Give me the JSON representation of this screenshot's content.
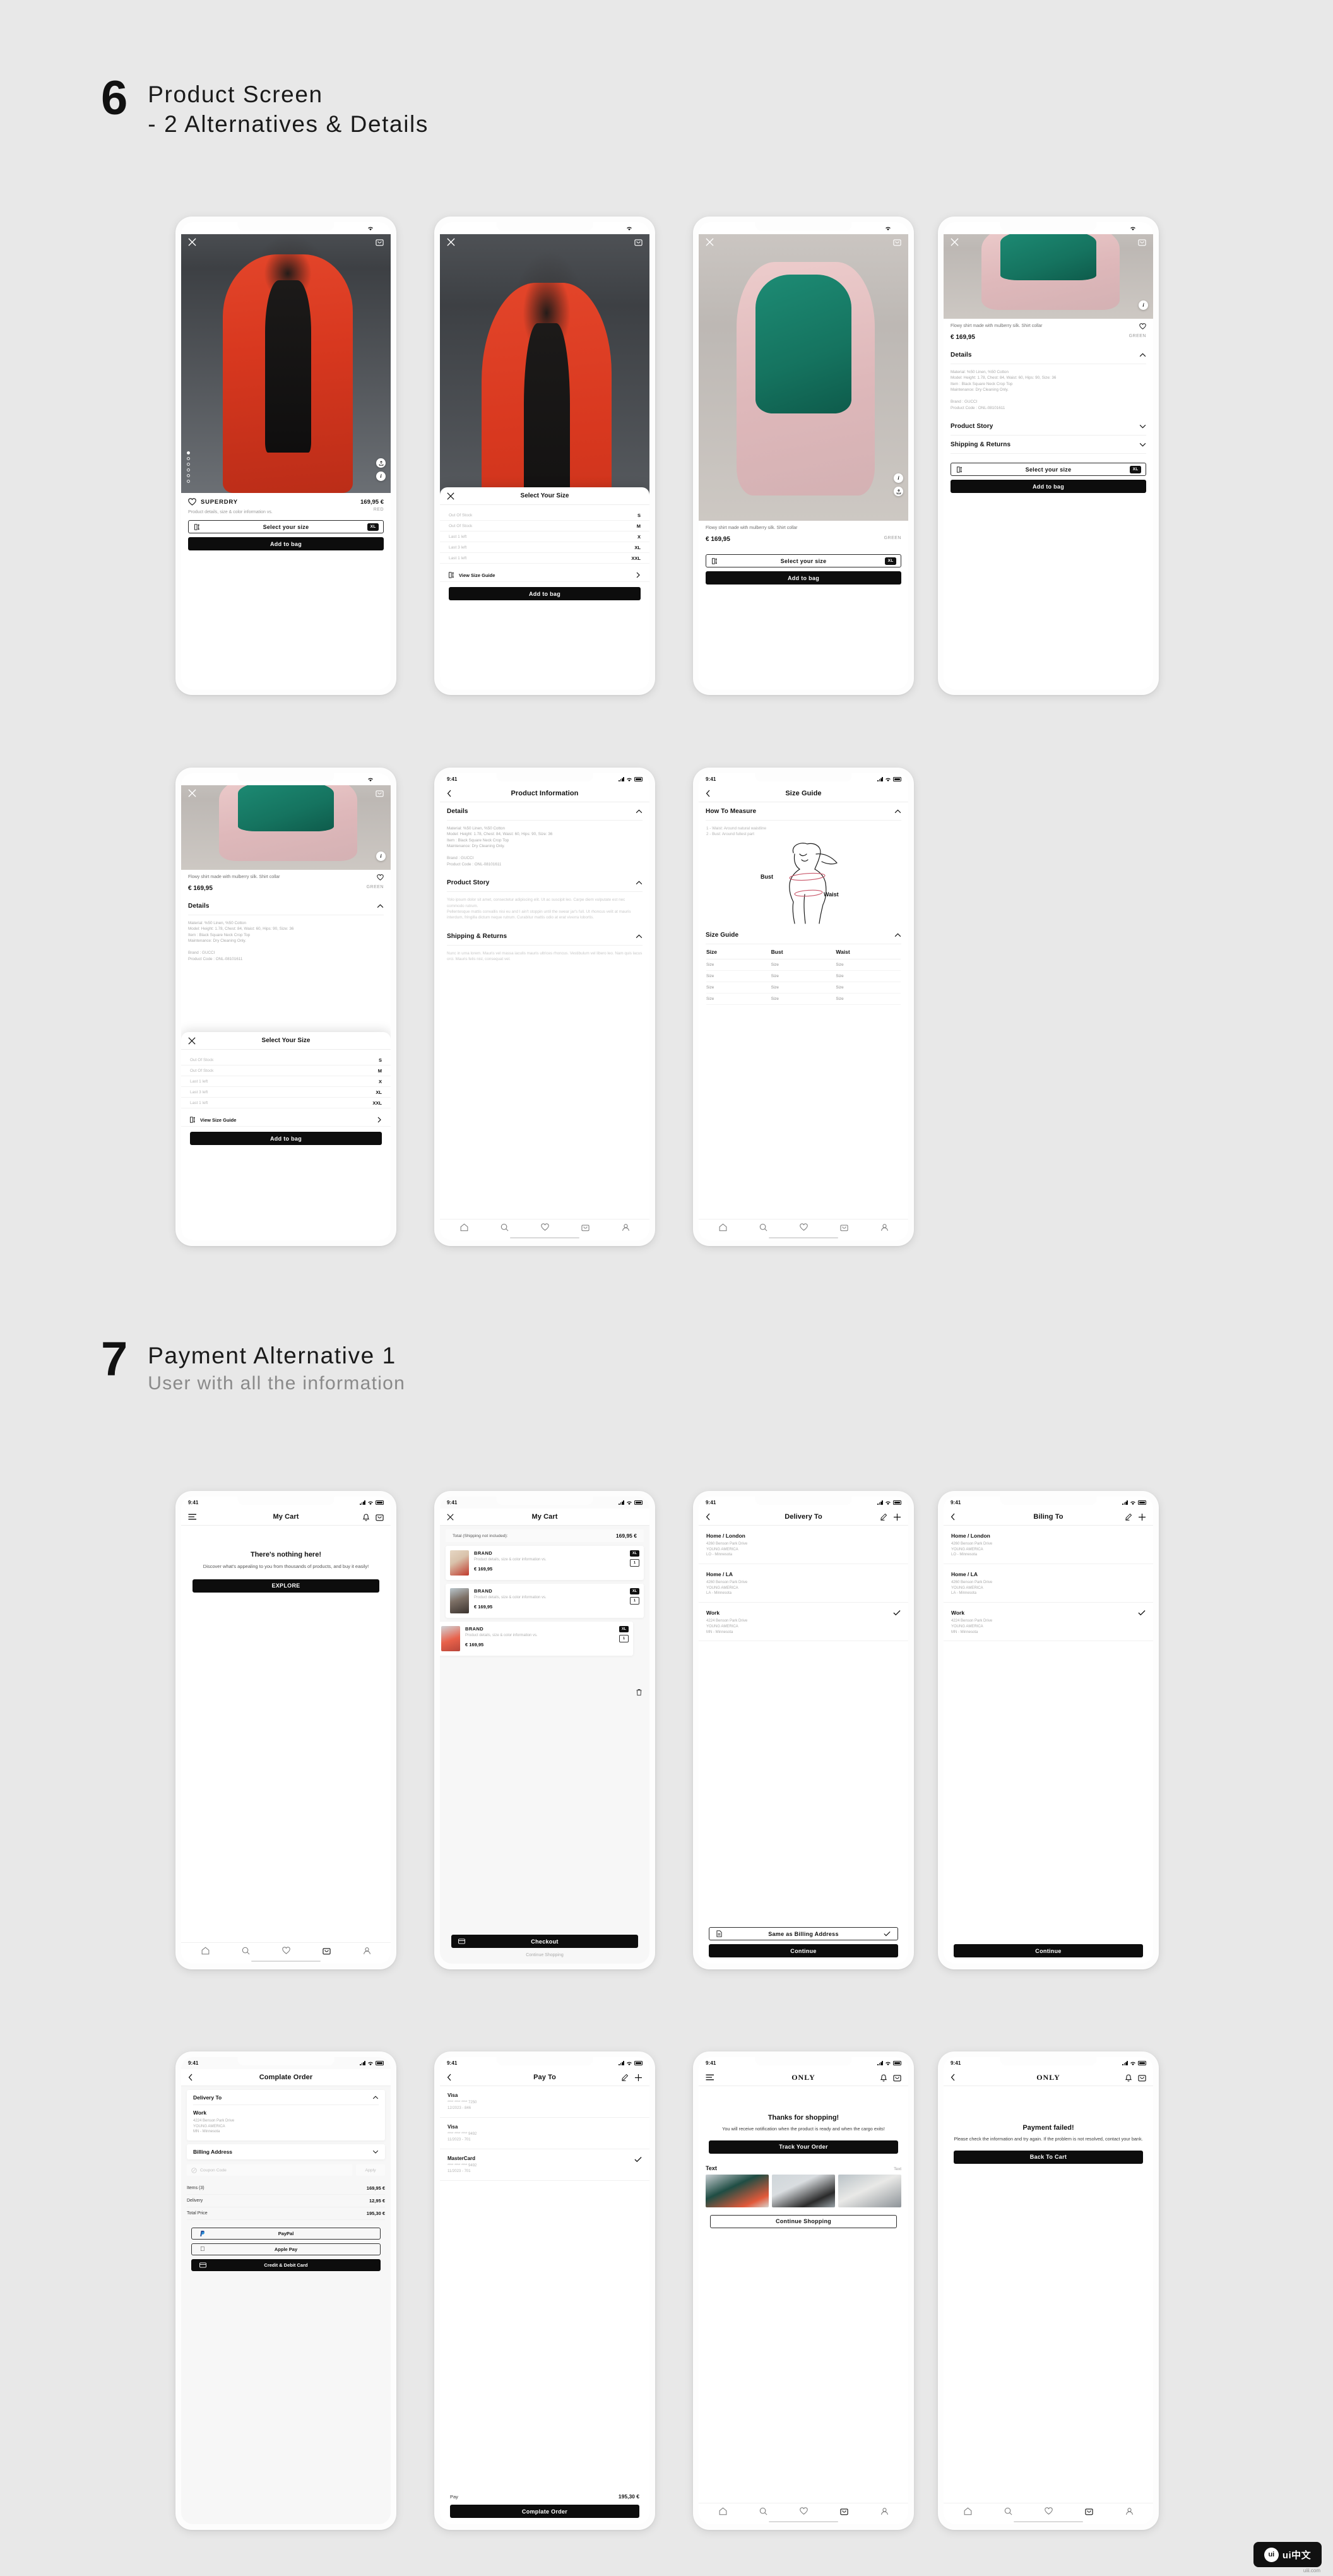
{
  "sections": [
    {
      "number": "6",
      "title_line1": "Product Screen",
      "title_line2": "- 2 Alternatives & Details",
      "subtitle": ""
    },
    {
      "number": "7",
      "title_line1": "Payment Alternative 1",
      "title_line2": "",
      "subtitle": "User with all the information"
    }
  ],
  "status": {
    "time": "9:41"
  },
  "common": {
    "add_to_bag": "Add to bag",
    "select_your_size": "Select your size",
    "size_badge": "XL",
    "view_size_guide": "View Size Guide",
    "continue": "Continue",
    "details": "Details",
    "product_story": "Product Story",
    "shipping_returns": "Shipping & Returns",
    "brand_wordmark": "ONLY"
  },
  "product": {
    "brand": "SUPERDRY",
    "price": "169,95 €",
    "price_eur_prefix": "€ 169,95",
    "color_red": "RED",
    "color_green": "GREEN",
    "short_desc": "Product details, size & color information vs.",
    "long_desc": "Flowy shirt made with mulberry silk. Shirt collar",
    "details_body": "Material: %50 Linen, %50 Cotton\nModel: Height: 1.78, Chest: 84, Waist: 60, Hips: 90, Size: 36\nItem : Black Square Neck Crop Top\nMaintenance: Dry Cleaning Only.\n\nBrand : GUCCI\nProduct Code : ONL-08101611",
    "story_body": "Yolo ipsum dolor sit amet, consectetur adipiscing elit. Ut ac suscipit leo. Carpe diem vulputate est nec commodo rutrum.\nPellentesque mattis convallis nisi eu and I ain't stoppin until the swear jar's full. Ut rhoncus velit at mauris interdum, fringilla dictum neque rutrum. Curabitur mattis odio at erat viverra lobortis.",
    "shipping_body": "Nunc in urna lorem. Mauris vel massa iaculis mauris ultrices rhoncus. Vestibulum vel libero leo. Nam quis lacus orci. Mauris felis nisl, consequat vel."
  },
  "size_sheet": {
    "title": "Select Your Size",
    "rows": [
      {
        "stock": "Out Of Stock",
        "size": "S"
      },
      {
        "stock": "Out Of Stock",
        "size": "M"
      },
      {
        "stock": "Last 1 left",
        "size": "X"
      },
      {
        "stock": "Last 3 left",
        "size": "XL"
      },
      {
        "stock": "Last 1 left",
        "size": "XXL"
      }
    ]
  },
  "product_information": {
    "nav_title": "Product Information"
  },
  "size_guide": {
    "nav_title": "Size Guide",
    "how_to_measure": "How To Measure",
    "measure_body": "1 - Waist: Around natural waistline\n2 - Bust: Around fullest part",
    "diagram_labels": {
      "bust": "Bust",
      "waist": "Waist"
    },
    "section_title": "Size Guide",
    "table_headers": [
      "Size",
      "Bust",
      "Waist"
    ],
    "table_rows": [
      [
        "Size",
        "Size",
        "Size"
      ],
      [
        "Size",
        "Size",
        "Size"
      ],
      [
        "Size",
        "Size",
        "Size"
      ],
      [
        "Size",
        "Size",
        "Size"
      ]
    ]
  },
  "cart_empty": {
    "nav_title": "My Cart",
    "heading": "There's nothing here!",
    "body": "Discover what's appealing to you from thousands of products, and buy it easily!",
    "cta": "EXPLORE"
  },
  "cart_filled": {
    "nav_title": "My Cart",
    "total_label": "Total (Shipping not included):",
    "total_value": "169,95 €",
    "items": [
      {
        "brand": "BRAND",
        "desc": "Product details, size & color information vs.",
        "price": "€ 169,95",
        "size": "XL",
        "qty": "1"
      },
      {
        "brand": "BRAND",
        "desc": "Product details, size & color information vs.",
        "price": "€ 169,95",
        "size": "XL",
        "qty": "1"
      },
      {
        "brand": "BRAND",
        "desc": "Product details, size & color information vs.",
        "price": "€ 169,95",
        "size": "XL",
        "qty": "1"
      }
    ],
    "checkout": "Checkout",
    "continue_shopping": "Continue Shopping"
  },
  "delivery_to": {
    "nav_title": "Delivery To",
    "addresses": [
      {
        "title": "Home / London",
        "lines": "4260  Benson Park Drive\nYOUNG AMERICA\nLO - Minnesota",
        "selected": false
      },
      {
        "title": "Home / LA",
        "lines": "4260  Benson Park Drive\nYOUNG AMERICA\nLA - Minnesota",
        "selected": false
      },
      {
        "title": "Work",
        "lines": "4224  Benson Park Drive\nYOUNG AMERICA\nMN - Minnesota",
        "selected": true
      }
    ],
    "same_as_billing": "Same as Billing Address",
    "continue": "Continue"
  },
  "billing_to": {
    "nav_title": "Biling To",
    "addresses": [
      {
        "title": "Home / London",
        "lines": "4260  Benson Park Drive\nYOUNG AMERICA\nLO - Minnesota",
        "selected": false
      },
      {
        "title": "Home / LA",
        "lines": "4260  Benson Park Drive\nYOUNG AMERICA\nLA - Minnesota",
        "selected": false
      },
      {
        "title": "Work",
        "lines": "4224  Benson Park Drive\nYOUNG AMERICA\nMN - Minnesota",
        "selected": true
      }
    ],
    "continue": "Continue"
  },
  "complete_order": {
    "nav_title": "Complate Order",
    "delivery_to": "Delivery To",
    "address_title": "Work",
    "address_lines": "4224  Benson Park Drive\nYOUNG AMERICA\nMN - Minnesota",
    "billing_address": "Billing Address",
    "coupon_placeholder": "Coupon Code",
    "apply": "Apply",
    "summary": [
      {
        "label": "Items (3)",
        "value": "169,95 €"
      },
      {
        "label": "Delivery",
        "value": "12,95 €"
      },
      {
        "label": "Total Price",
        "value": "195,30 €"
      }
    ],
    "paypal": "PayPal",
    "apple_pay": "Apple Pay",
    "credit_debit": "Credit & Debit Card"
  },
  "pay_to": {
    "nav_title": "Pay To",
    "cards": [
      {
        "name": "Visa",
        "number": "**** **** **** 7250\n12/2023 - 846",
        "selected": false
      },
      {
        "name": "Visa",
        "number": "**** **** **** 9492\n11/2023 - 701",
        "selected": false
      },
      {
        "name": "MasterCard",
        "number": "**** **** **** 9492\n11/2023 - 701",
        "selected": true
      }
    ],
    "pay_label": "Pay",
    "pay_value": "195,30 €",
    "complete_order": "Complate Order"
  },
  "success": {
    "nav_title": "ONLY",
    "heading": "Thanks for shopping!",
    "body": "You will receive notification when the product is ready and when the cargo exits!",
    "cta": "Track Your Order",
    "row_label": "Text",
    "row_link": "Text",
    "continue_shopping": "Continue Shopping"
  },
  "failed": {
    "nav_title": "ONLY",
    "heading": "Payment failed!",
    "body": "Please check the information and try again. If the problem is not resolved, contact your bank.",
    "cta": "Back To Cart"
  },
  "watermark": {
    "badge": "ui",
    "text": "ui中文",
    "sub": "uiii.com"
  }
}
